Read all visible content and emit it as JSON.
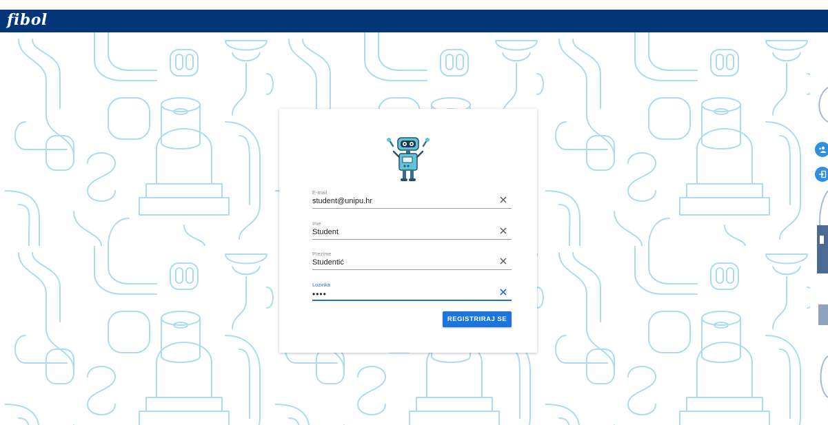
{
  "header": {
    "brand": "fibol"
  },
  "form": {
    "fields": [
      {
        "label": "E-mail",
        "value": "student@unipu.hr"
      },
      {
        "label": "Ime",
        "value": "Student"
      },
      {
        "label": "Prezime",
        "value": "Studentić"
      },
      {
        "label": "Lozinka",
        "value": "••••",
        "focused": true
      }
    ],
    "submit_label": "REGISTRIRAJ SE"
  },
  "side_buttons": [
    {
      "icon": "add-user-icon"
    },
    {
      "icon": "login-icon"
    }
  ],
  "colors": {
    "navbar": "#023679",
    "accent": "#1b75dc",
    "pattern": "#a9dcf2",
    "robot_body": "#5fc3dd"
  }
}
